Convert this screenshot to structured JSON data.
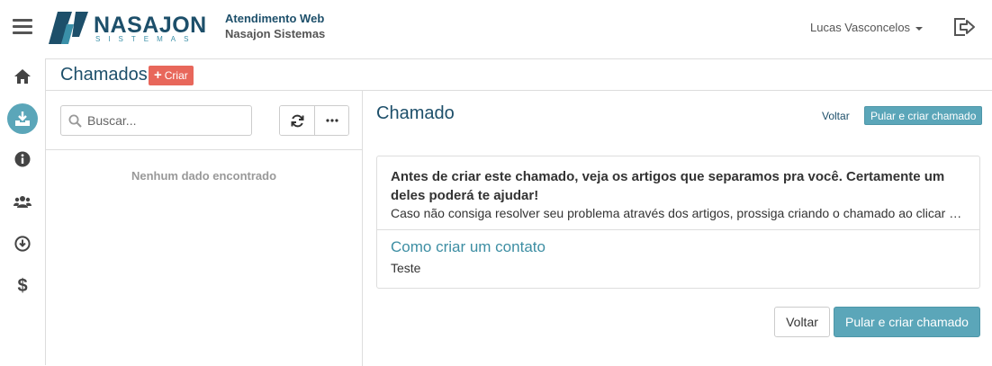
{
  "header": {
    "logo_text": "NASAJON",
    "logo_subtext": "SISTEMAS",
    "app_title": "Atendimento Web",
    "company_name": "Nasajon Sistemas",
    "user_name": "Lucas Vasconcelos"
  },
  "sidebar": {
    "items": [
      {
        "icon": "home-icon"
      },
      {
        "icon": "inbox-download-icon",
        "active": true
      },
      {
        "icon": "info-icon"
      },
      {
        "icon": "users-icon"
      },
      {
        "icon": "download-circle-icon"
      },
      {
        "icon": "dollar-icon"
      }
    ]
  },
  "page": {
    "title": "Chamados",
    "create_label": "Criar"
  },
  "list": {
    "search_placeholder": "Buscar...",
    "empty_message": "Nenhum dado encontrado"
  },
  "detail": {
    "title": "Chamado",
    "back_link": "Voltar",
    "skip_create_small": "Pular e criar chamado",
    "card": {
      "heading": "Antes de criar este chamado, veja os artigos que separamos pra você. Certamente um deles poderá te ajudar!",
      "subtitle": "Caso não consiga resolver seu problema através dos artigos, prossiga criando o chamado ao clicar em \"Pular e criar chamado\".",
      "articles": [
        {
          "title": "Como criar um contato",
          "description": "Teste"
        }
      ]
    },
    "back_button": "Voltar",
    "skip_create_button": "Pular e criar chamado"
  },
  "colors": {
    "brand_dark": "#1d4f6a",
    "accent_teal": "#5ba6b9",
    "create_red": "#e8675b"
  }
}
